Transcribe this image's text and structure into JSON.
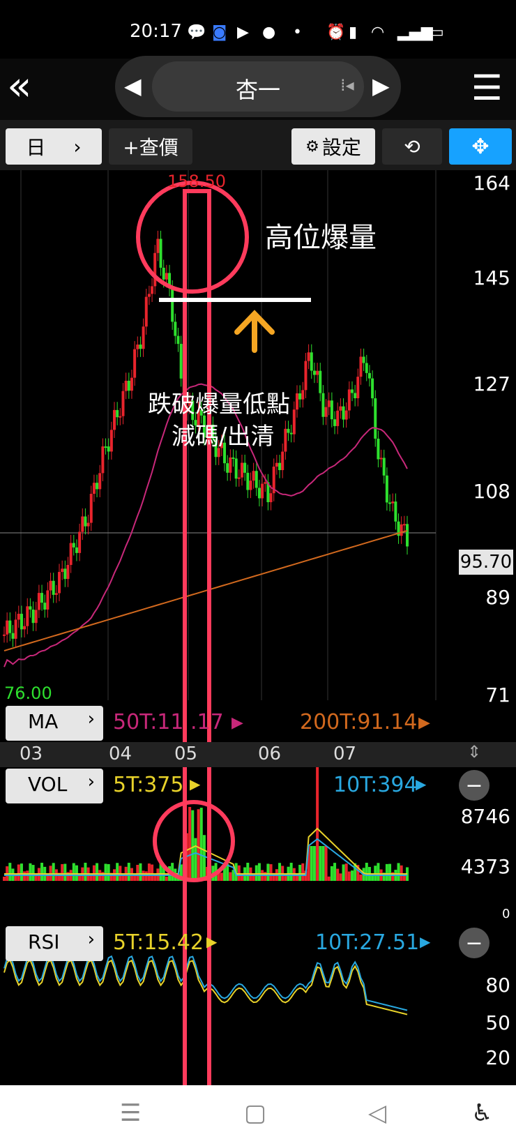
{
  "status_bar": {
    "time": "20:17"
  },
  "header": {
    "title": "杏一"
  },
  "toolbar": {
    "period": "日",
    "quote_button": "+查價",
    "settings_button": "設定"
  },
  "price_axis": {
    "ticks": [
      "164",
      "145",
      "127",
      "108",
      "89",
      "71"
    ],
    "last_price": "95.70",
    "high_label": "158.50",
    "low_label": "76.00"
  },
  "date_axis": {
    "months": [
      "03",
      "04",
      "05",
      "06",
      "07"
    ]
  },
  "ma_panel": {
    "label": "MA",
    "ma50": "50T:11 .17",
    "ma200": "200T:91.14"
  },
  "vol_panel": {
    "label": "VOL",
    "v5": "5T:375",
    "v10": "10T:394",
    "ticks": [
      "8746",
      "4373",
      "0"
    ]
  },
  "rsi_panel": {
    "label": "RSI",
    "r5": "5T:15.42",
    "r10": "10T:27.51",
    "ticks": [
      "80",
      "50",
      "20"
    ]
  },
  "annotations": {
    "high_volume": "高位爆量",
    "break_line_1": "跌破爆量低點",
    "break_line_2": "減碼/出清"
  },
  "colors": {
    "up": "#e8242c",
    "down": "#2ee02e",
    "ma50": "#c8287a",
    "ma200": "#d2691e",
    "highlight": "#ff3b5c",
    "arrow": "#f5a623",
    "accent": "#1e9bff"
  },
  "chart_data": {
    "type": "candlestick",
    "approx_close_path": [
      78,
      80,
      82,
      85,
      88,
      94,
      100,
      110,
      118,
      125,
      135,
      150,
      140,
      120,
      118,
      114,
      110,
      108,
      106,
      104,
      112,
      120,
      130,
      120,
      118,
      122,
      130,
      110,
      100,
      95.7
    ],
    "ylim": [
      71,
      164
    ],
    "high": 158.5,
    "low": 76.0
  }
}
